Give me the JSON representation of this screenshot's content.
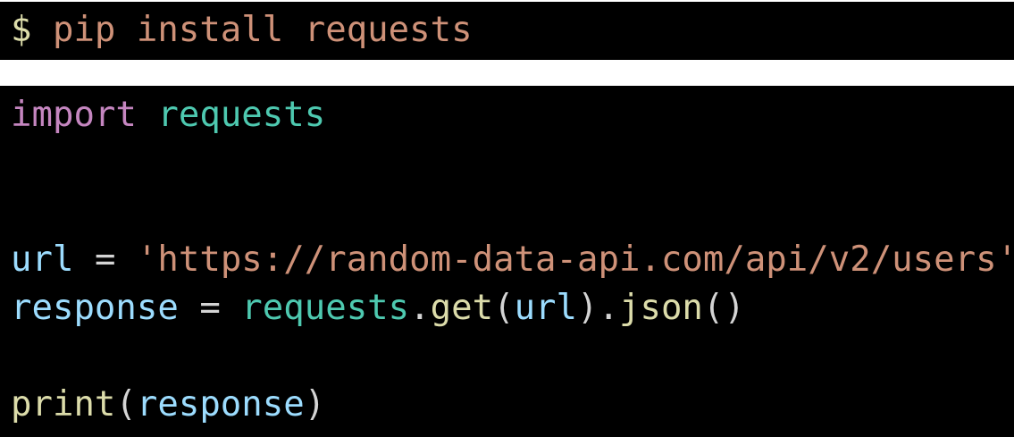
{
  "shell": {
    "prompt": "$",
    "command": "pip install requests"
  },
  "code": {
    "line1": {
      "keyword": "import",
      "module": "requests"
    },
    "line4": {
      "var": "url",
      "op": "=",
      "string": "'https://random-data-api.com/api/v2/users'"
    },
    "line5": {
      "var": "response",
      "op": "=",
      "module": "requests",
      "dot1": ".",
      "func": "get",
      "open1": "(",
      "arg": "url",
      "close1": ")",
      "dot2": ".",
      "method": "json",
      "parens": "()"
    },
    "line7": {
      "func": "print",
      "open": "(",
      "arg": "response",
      "close": ")"
    }
  },
  "colors": {
    "background": "#000000",
    "keyword": "#c586c0",
    "module": "#4ec9b0",
    "variable": "#9cdcfe",
    "string": "#ce9178",
    "function": "#dcdcaa",
    "plain": "#d4d4d4"
  }
}
